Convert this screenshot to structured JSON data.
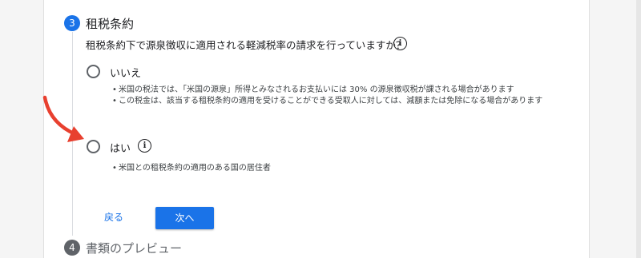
{
  "step3": {
    "number": "3",
    "title": "租税条約",
    "question": "租税条約下で源泉徴収に適用される軽減税率の請求を行っていますか？",
    "info_icon_glyph": "i"
  },
  "options": [
    {
      "label": "いいえ",
      "selected": false,
      "bullets": [
        "米国の税法では、「米国の源泉」所得とみなされるお支払いには 30% の源泉徴収税が課される場合があります",
        "この税金は、該当する租税条約の適用を受けることができる受取人に対しては、減額または免除になる場合があります"
      ]
    },
    {
      "label": "はい",
      "selected": false,
      "has_info_icon": true,
      "bullets": [
        "米国との租税条約の適用のある国の居住者"
      ]
    }
  ],
  "actions": {
    "back_label": "戻る",
    "next_label": "次へ"
  },
  "step4": {
    "number": "4",
    "title": "書類のプレビュー"
  },
  "colors": {
    "accent": "#1a73e8",
    "arrow": "#e8402f",
    "inactive_step": "#5f6368"
  }
}
